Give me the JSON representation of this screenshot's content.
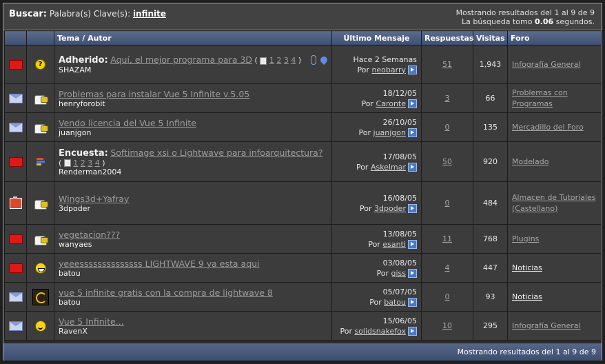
{
  "search": {
    "label": "Buscar:",
    "keywords_label": "Palabra(s) Clave(s):",
    "keyword": "infinite",
    "results_summary": "Mostrando resultados del 1 al 9 de 9",
    "time_prefix": "La búsqueda tomo",
    "time_value": "0.06",
    "time_suffix": "segundos."
  },
  "columns": {
    "topic_author": "Tema / Autor",
    "last_post": "Último Mensaje",
    "replies": "Respuestas",
    "views": "Visitas",
    "forum": "Foro"
  },
  "rows": [
    {
      "label": "Adherido:",
      "title": "Aquí, el mejor programa para 3D",
      "pages": [
        "1",
        "2",
        "3",
        "4"
      ],
      "author": "SHAZAM",
      "date": "Hace 2 Semanas",
      "by_prefix": "Por",
      "by": "neobarry",
      "replies": "51",
      "views": "1,943",
      "forum": "Infografía General",
      "status_icon": "folder-hot-icon",
      "type_icon": "question-icon"
    },
    {
      "label": "",
      "title": "Problemas para instalar Vue 5 Infinite v.5.05",
      "pages": [],
      "author": "henryforobit",
      "date": "18/12/05",
      "by_prefix": "Por",
      "by": "Caronte",
      "replies": "3",
      "views": "66",
      "forum": "Problemas con Programas",
      "status_icon": "envelope-icon",
      "type_icon": "pointing-hand-icon"
    },
    {
      "label": "",
      "title": "Vendo licencia del Vue 5 Infinite",
      "pages": [],
      "author": "juanjgon",
      "date": "26/10/05",
      "by_prefix": "Por",
      "by": "juanjgon",
      "replies": "0",
      "views": "135",
      "forum": "Mercadillo del Foro",
      "status_icon": "envelope-icon",
      "type_icon": "pointing-hand-icon"
    },
    {
      "label": "Encuesta:",
      "title": "Softimage xsi o Lightwave para infoarquitectura?",
      "pages": [
        "1",
        "2",
        "3",
        "4"
      ],
      "author": "Renderman2004",
      "date": "17/08/05",
      "by_prefix": "Por",
      "by": "Askelmar",
      "replies": "50",
      "views": "920",
      "forum": "Modelado",
      "status_icon": "folder-hot-icon",
      "type_icon": "poll-bars-icon"
    },
    {
      "label": "",
      "title": "Wings3d+Yafray",
      "pages": [],
      "author": "3dpoder",
      "date": "16/08/05",
      "by_prefix": "Por",
      "by": "3dpoder",
      "replies": "0",
      "views": "484",
      "forum": "Almacen de Tutoriales (Castellano)",
      "status_icon": "clipboard-icon",
      "type_icon": "pointing-hand-icon"
    },
    {
      "label": "",
      "title": "vegetacion???",
      "pages": [],
      "author": "wanyaes",
      "date": "13/08/05",
      "by_prefix": "Por",
      "by": "esanti",
      "replies": "11",
      "views": "768",
      "forum": "Plugins",
      "status_icon": "folder-hot-icon",
      "type_icon": "pointing-hand-icon"
    },
    {
      "label": "",
      "title": "yeeessssssssssssss LIGHTWAVE 9 ya esta aqui",
      "pages": [],
      "author": "batou",
      "date": "03/08/05",
      "by_prefix": "Por",
      "by": "giss",
      "replies": "4",
      "views": "447",
      "forum": "Noticias",
      "status_icon": "folder-hot-icon",
      "type_icon": "grin-icon"
    },
    {
      "label": "",
      "title": "vue 5 infinite gratis con la compra de lightwave 8",
      "pages": [],
      "author": "batou",
      "date": "05/07/05",
      "by_prefix": "Por",
      "by": "batou",
      "replies": "0",
      "views": "93",
      "forum": "Noticias",
      "status_icon": "envelope-icon",
      "type_icon": "swirl-icon"
    },
    {
      "label": "",
      "title": "Vue 5 Infinite...",
      "pages": [],
      "author": "RavenX",
      "date": "15/06/05",
      "by_prefix": "Por",
      "by": "solidsnakefox",
      "replies": "10",
      "views": "295",
      "forum": "Infografía General",
      "status_icon": "envelope-icon",
      "type_icon": "smile-icon"
    }
  ],
  "footer": {
    "results_summary": "Mostrando resultados del 1 al 9 de 9"
  }
}
